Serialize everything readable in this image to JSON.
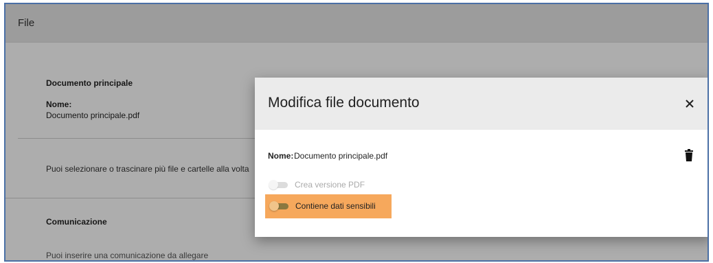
{
  "page": {
    "header_title": "File",
    "main_document": {
      "section_title": "Documento principale",
      "name_label": "Nome:",
      "name_value": "Documento principale.pdf"
    },
    "upload_hint": "Puoi selezionare o trascinare più file e cartelle alla volta",
    "communication": {
      "section_title": "Comunicazione",
      "hint": "Puoi inserire una comunicazione da allegare"
    }
  },
  "modal": {
    "title": "Modifica file documento",
    "name_label": "Nome:",
    "name_value": "Documento principale.pdf",
    "close_icon": "close-icon",
    "delete_icon": "trash-icon",
    "toggles": [
      {
        "label": "Crea versione PDF",
        "enabled": false,
        "checked": false
      },
      {
        "label": "Contiene dati sensibili",
        "enabled": true,
        "checked": false,
        "highlighted": true
      }
    ]
  },
  "colors": {
    "highlight": "#f6a85c",
    "frame_border": "#4a6fa5",
    "modal_header": "#ebebeb"
  }
}
